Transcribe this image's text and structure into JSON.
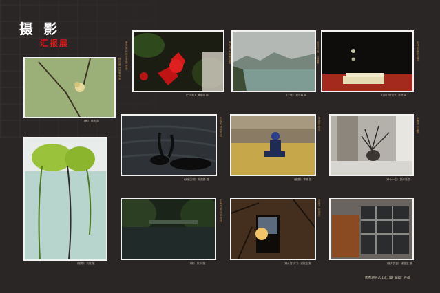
{
  "title": {
    "main": "摄 影",
    "sub": "汇报展"
  },
  "photos": [
    {
      "caption": "《梅》 邱波 摄"
    },
    {
      "caption": "《一点红》 黄丽丽 摄"
    },
    {
      "caption": "《三峡》 吴可馨 摄"
    },
    {
      "caption": "《去往的日记》 孙婷 摄"
    },
    {
      "caption": "《天鹅之吻》 姚蕾蕾 摄"
    },
    {
      "caption": "《稚趣》 李娜 摄"
    },
    {
      "caption": "《嫁今一位》 张泽凝 摄"
    },
    {
      "caption": "《常青》 刘敏 摄"
    },
    {
      "caption": "《湖》 张非 摄"
    },
    {
      "caption": "《转木落“灯”》 谢婉玉 摄"
    },
    {
      "caption": "《废弃的窗》 谢莹莹 摄"
    }
  ],
  "side_notes": {
    "n1": "鲜花盛开的季节里",
    "n2": "春天如约而至不期而遇",
    "n3": "青山绿水烟雨朦胧",
    "n4": "远处灯光一片温暖",
    "n5": "如诗如画的意境",
    "n6": "天真无邪的笑容",
    "n7": "静谧的时光",
    "n8": "水面波光粼粼",
    "n9": "老房子的回忆",
    "n10": "生命在岁月中延续"
  },
  "footer": "优秀期刊2013(1)期  编辑：卢晨"
}
